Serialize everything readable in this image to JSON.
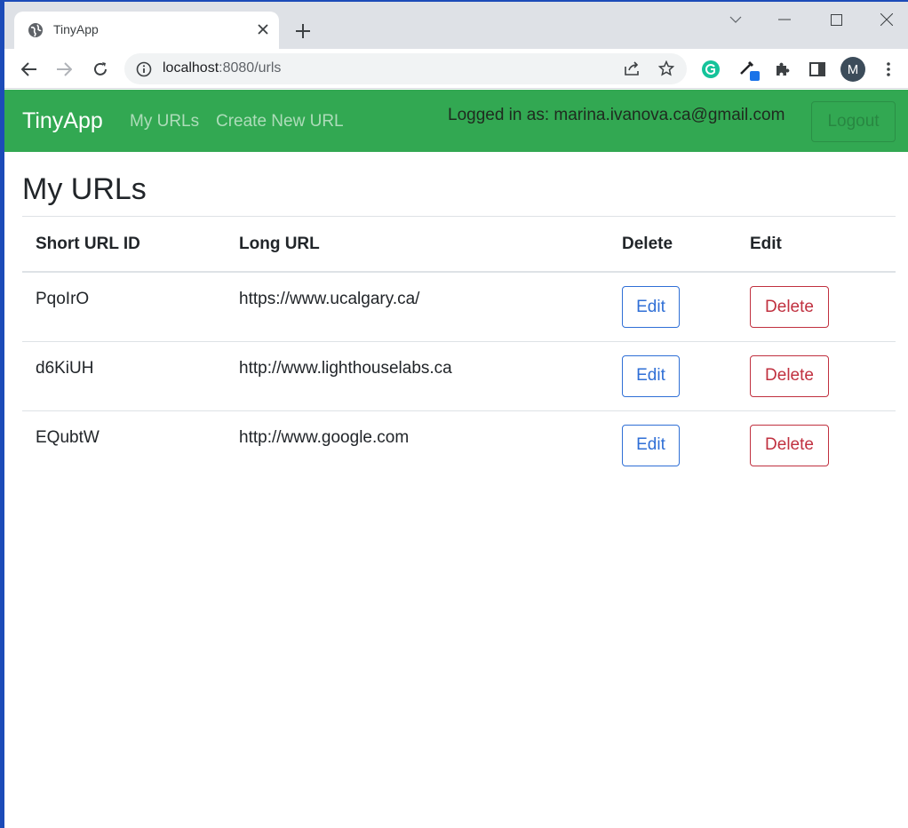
{
  "browser": {
    "tab_title": "TinyApp",
    "url_host": "localhost",
    "url_rest": ":8080/urls",
    "profile_initial": "M"
  },
  "navbar": {
    "brand": "TinyApp",
    "links": [
      "My URLs",
      "Create New URL"
    ],
    "logged_in_text": "Logged in as: marina.ivanova.ca@gmail.com",
    "logout_label": "Logout",
    "bg_color": "#32a852"
  },
  "page": {
    "heading": "My URLs"
  },
  "table": {
    "headers": [
      "Short URL ID",
      "Long URL",
      "Delete",
      "Edit"
    ],
    "rows": [
      {
        "short_id": "PqoIrO",
        "long_url": "https://www.ucalgary.ca/",
        "edit_label": "Edit",
        "delete_label": "Delete"
      },
      {
        "short_id": "d6KiUH",
        "long_url": "http://www.lighthouselabs.ca",
        "edit_label": "Edit",
        "delete_label": "Delete"
      },
      {
        "short_id": "EQubtW",
        "long_url": "http://www.google.com",
        "edit_label": "Edit",
        "delete_label": "Delete"
      }
    ]
  },
  "icons": [
    "globe-icon",
    "close-icon",
    "plus-icon",
    "chevron-down-icon",
    "minimize-icon",
    "maximize-icon",
    "window-close-icon",
    "back-icon",
    "forward-icon",
    "reload-icon",
    "info-icon",
    "share-icon",
    "star-icon",
    "grammarly-icon",
    "eyedropper-icon",
    "extensions-icon",
    "sidepanel-icon",
    "more-icon"
  ]
}
